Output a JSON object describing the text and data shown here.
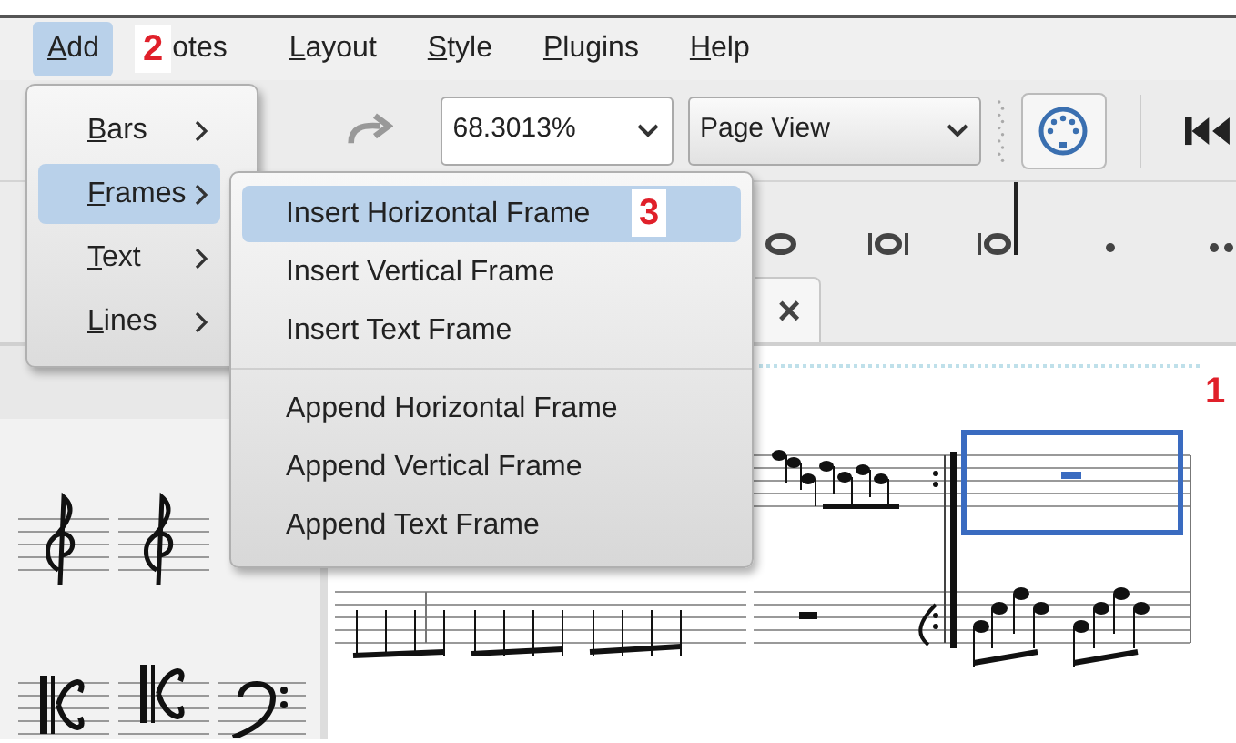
{
  "menubar": {
    "items": [
      {
        "label": "Add",
        "selected": true,
        "mnemonic": true
      },
      {
        "label": "otes",
        "selected": false,
        "mnemonic": false
      },
      {
        "label": "Layout",
        "selected": false,
        "mnemonic": true
      },
      {
        "label": "Style",
        "selected": false,
        "mnemonic": true
      },
      {
        "label": "Plugins",
        "selected": false,
        "mnemonic": true
      },
      {
        "label": "Help",
        "selected": false,
        "mnemonic": true
      }
    ],
    "callout": "2"
  },
  "toolbar": {
    "zoom": "68.3013%",
    "view": "Page View"
  },
  "document_tab": {
    "close": "×"
  },
  "add_menu": {
    "items": [
      {
        "label": "Bars",
        "selected": false
      },
      {
        "label": "Frames",
        "selected": true
      },
      {
        "label": "Text",
        "selected": false
      },
      {
        "label": "Lines",
        "selected": false
      }
    ]
  },
  "frames_submenu": {
    "callout": "3",
    "groups": [
      [
        {
          "label": "Insert Horizontal Frame",
          "selected": true
        },
        {
          "label": "Insert Vertical Frame",
          "selected": false
        },
        {
          "label": "Insert Text Frame",
          "selected": false
        }
      ],
      [
        {
          "label": "Append Horizontal Frame",
          "selected": false
        },
        {
          "label": "Append Vertical Frame",
          "selected": false
        },
        {
          "label": "Append Text Frame",
          "selected": false
        }
      ]
    ]
  },
  "score": {
    "callout": "1"
  }
}
